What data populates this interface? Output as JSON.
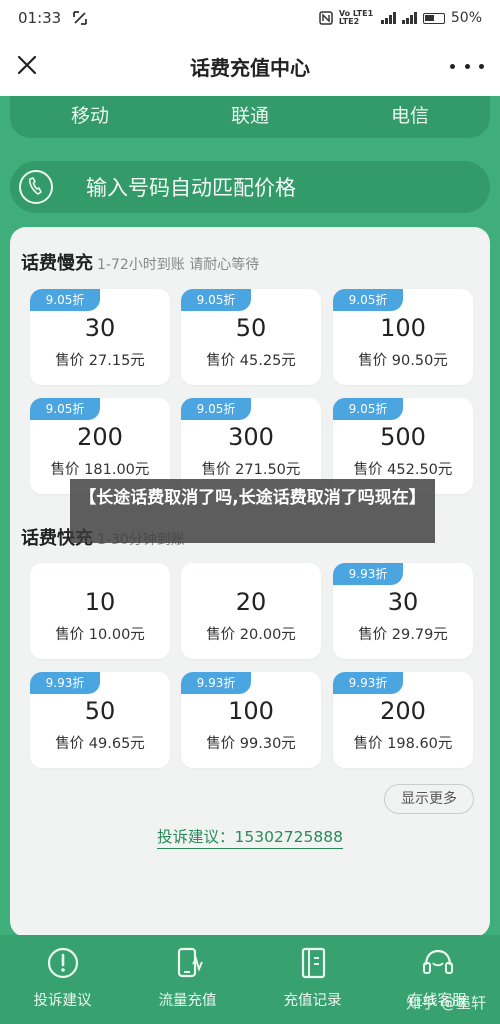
{
  "status_bar": {
    "time": "01:33",
    "network": "Vo LTE1 LTE2",
    "battery": "50%"
  },
  "header": {
    "title": "话费充值中心"
  },
  "tabs": [
    {
      "label": "移动"
    },
    {
      "label": "联通"
    },
    {
      "label": "电信"
    }
  ],
  "search": {
    "placeholder": "输入号码自动匹配价格"
  },
  "slow_section": {
    "title": "话费慢充",
    "subtitle": "1-72小时到账 请耐心等待",
    "cards": [
      {
        "badge": "9.05折",
        "amount": "30",
        "price": "售价 27.15元"
      },
      {
        "badge": "9.05折",
        "amount": "50",
        "price": "售价 45.25元"
      },
      {
        "badge": "9.05折",
        "amount": "100",
        "price": "售价 90.50元"
      },
      {
        "badge": "9.05折",
        "amount": "200",
        "price": "售价 181.00元"
      },
      {
        "badge": "9.05折",
        "amount": "300",
        "price": "售价 271.50元"
      },
      {
        "badge": "9.05折",
        "amount": "500",
        "price": "售价 452.50元"
      }
    ]
  },
  "fast_section": {
    "title": "话费快充",
    "subtitle": "1-30分钟到账",
    "cards": [
      {
        "badge": "",
        "amount": "10",
        "price": "售价 10.00元"
      },
      {
        "badge": "",
        "amount": "20",
        "price": "售价 20.00元"
      },
      {
        "badge": "9.93折",
        "amount": "30",
        "price": "售价 29.79元"
      },
      {
        "badge": "9.93折",
        "amount": "50",
        "price": "售价 49.65元"
      },
      {
        "badge": "9.93折",
        "amount": "100",
        "price": "售价 99.30元"
      },
      {
        "badge": "9.93折",
        "amount": "200",
        "price": "售价 198.60元"
      }
    ]
  },
  "show_more": "显示更多",
  "complaint": "投诉建议：15302725888",
  "overlay_text": "【长途话费取消了吗,长途话费取消了吗现在】",
  "bottom_nav": [
    {
      "label": "投诉建议",
      "icon": "alert-circle-icon"
    },
    {
      "label": "流量充值",
      "icon": "phone-data-icon"
    },
    {
      "label": "充值记录",
      "icon": "record-book-icon"
    },
    {
      "label": "在线客服",
      "icon": "headset-icon"
    }
  ],
  "watermark": "知乎 @墨轩",
  "colors": {
    "primary_green": "#3fae7b",
    "dark_green": "#339a69",
    "badge_blue": "#4aa5e0",
    "panel_bg": "#f0f3f1"
  }
}
